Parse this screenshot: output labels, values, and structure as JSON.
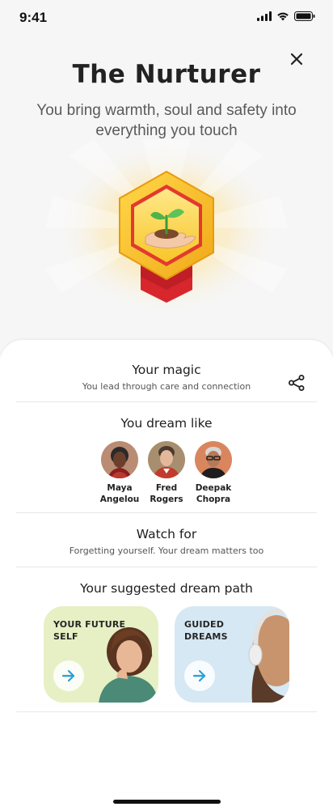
{
  "status_bar": {
    "time": "9:41"
  },
  "header": {
    "title": "The Nurturer",
    "subtitle": "You bring warmth, soul and safety into everything you touch"
  },
  "magic": {
    "title": "Your magic",
    "subtitle": "You lead through care and connection"
  },
  "dream_like": {
    "title": "You dream like",
    "people": [
      {
        "first": "Maya",
        "last": "Angelou"
      },
      {
        "first": "Fred",
        "last": "Rogers"
      },
      {
        "first": "Deepak",
        "last": "Chopra"
      }
    ]
  },
  "watch_for": {
    "title": "Watch for",
    "subtitle": "Forgetting yourself. Your dream matters too"
  },
  "dream_path": {
    "title": "Your suggested dream path",
    "cards": [
      {
        "label_line1": "YOUR FUTURE",
        "label_line2": "SELF",
        "bg": "#e6f0c4"
      },
      {
        "label_line1": "GUIDED",
        "label_line2": "DREAMS",
        "bg": "#d5e8f3"
      }
    ]
  },
  "colors": {
    "accent_arrow": "#2a9fd8",
    "badge_gold": "#f7c320",
    "badge_ribbon": "#d8262d"
  },
  "icons": {
    "close": "close-icon",
    "share": "share-icon",
    "arrow": "arrow-right-icon",
    "badge": "seedling-hand-icon"
  }
}
